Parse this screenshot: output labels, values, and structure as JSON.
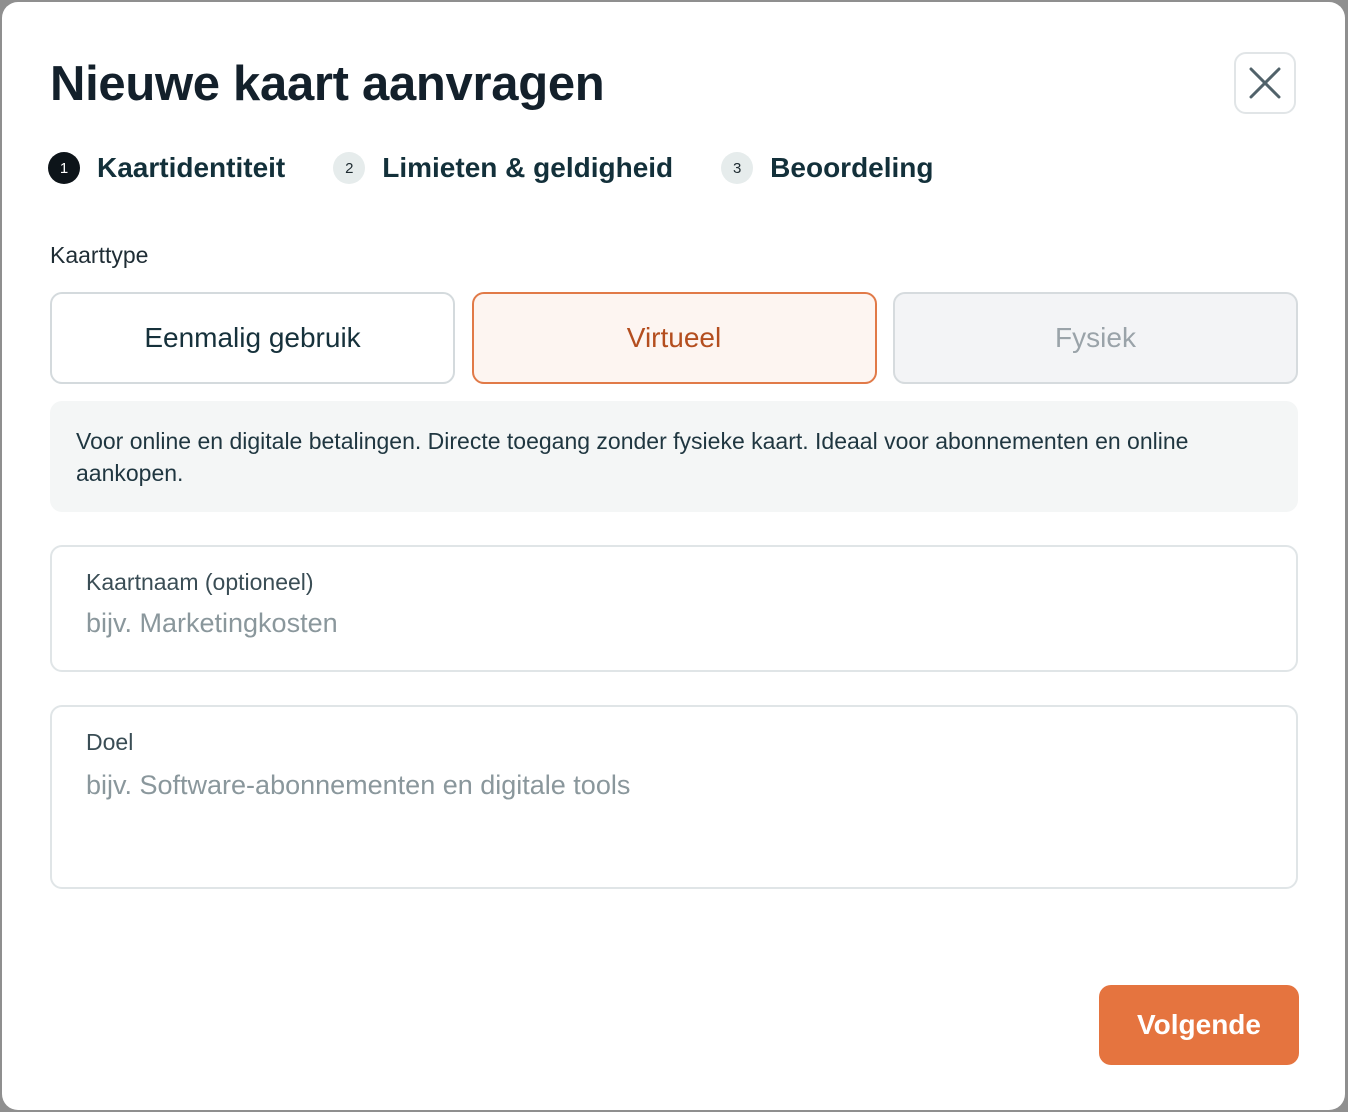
{
  "dialog": {
    "title": "Nieuwe kaart aanvragen",
    "close_icon": "close-icon"
  },
  "steps": [
    {
      "number": "1",
      "label": "Kaartidentiteit",
      "state": "active"
    },
    {
      "number": "2",
      "label": "Limieten & geldigheid",
      "state": "inactive"
    },
    {
      "number": "3",
      "label": "Beoordeling",
      "state": "inactive"
    }
  ],
  "card_type": {
    "label": "Kaarttype",
    "options": [
      {
        "label": "Eenmalig gebruik",
        "state": "default"
      },
      {
        "label": "Virtueel",
        "state": "selected"
      },
      {
        "label": "Fysiek",
        "state": "disabled"
      }
    ],
    "description": "Voor online en digitale betalingen. Directe toegang zonder fysieke kaart. Ideaal voor abonnementen en online aankopen."
  },
  "fields": {
    "card_name": {
      "label": "Kaartnaam (optioneel)",
      "value": "",
      "placeholder": "bijv. Marketingkosten"
    },
    "purpose": {
      "label": "Doel",
      "value": "",
      "placeholder": "bijv. Software-abonnementen en digitale tools"
    }
  },
  "actions": {
    "next_label": "Volgende"
  },
  "colors": {
    "accent": "#e5743f",
    "selected_border": "#e17a48",
    "selected_text": "#b44e1f",
    "title_text": "#13202b"
  }
}
